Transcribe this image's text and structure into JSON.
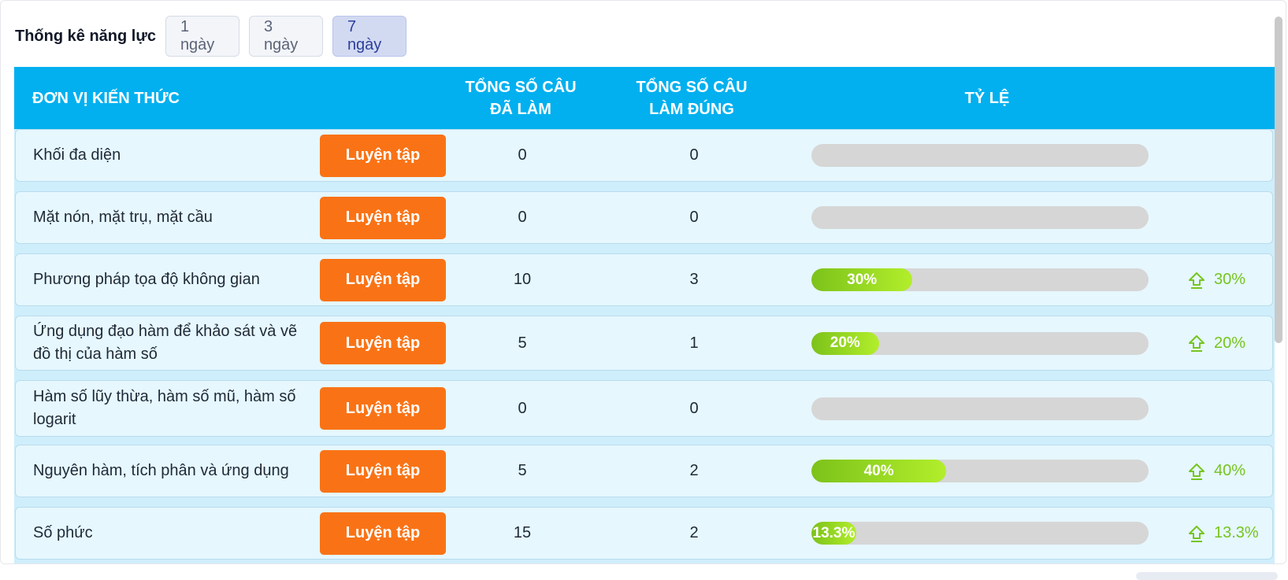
{
  "header": {
    "title": "Thống kê năng lực",
    "ranges": [
      "1 ngày",
      "3 ngày",
      "7 ngày"
    ],
    "active_range": "7 ngày"
  },
  "table": {
    "columns": {
      "name": "ĐƠN VỊ KIẾN THỨC",
      "done_line1": "TỔNG SỐ CÂU",
      "done_line2": "ĐÃ LÀM",
      "right_line1": "TỔNG SỐ CÂU",
      "right_line2": "LÀM ĐÚNG",
      "rate": "TỶ LỆ"
    },
    "practice_label": "Luyện tập",
    "rows": [
      {
        "name": "Khối đa diện",
        "done": "0",
        "right": "0",
        "rate": 0,
        "rate_label": "",
        "trend": ""
      },
      {
        "name": "Mặt nón, mặt trụ, mặt cầu",
        "done": "0",
        "right": "0",
        "rate": 0,
        "rate_label": "",
        "trend": ""
      },
      {
        "name": "Phương pháp tọa độ không gian",
        "done": "10",
        "right": "3",
        "rate": 0.3,
        "rate_label": "30%",
        "trend": "30%"
      },
      {
        "name": "Ứng dụng đạo hàm để khảo sát và vẽ đồ thị của hàm số",
        "done": "5",
        "right": "1",
        "rate": 0.2,
        "rate_label": "20%",
        "trend": "20%"
      },
      {
        "name": "Hàm số lũy thừa, hàm số mũ, hàm số logarit",
        "done": "0",
        "right": "0",
        "rate": 0,
        "rate_label": "",
        "trend": ""
      },
      {
        "name": "Nguyên hàm, tích phân và ứng dụng",
        "done": "5",
        "right": "2",
        "rate": 0.4,
        "rate_label": "40%",
        "trend": "40%"
      },
      {
        "name": "Số phức",
        "done": "15",
        "right": "2",
        "rate": 0.133,
        "rate_label": "13.3%",
        "trend": "13.3%"
      }
    ]
  },
  "colors": {
    "header_bg": "#02b0ef",
    "practice_button": "#f97316",
    "progress_fill": "#8fd421",
    "trend_up": "#76c51e"
  },
  "icons": {
    "trend": "arrow-up-outline-icon"
  }
}
